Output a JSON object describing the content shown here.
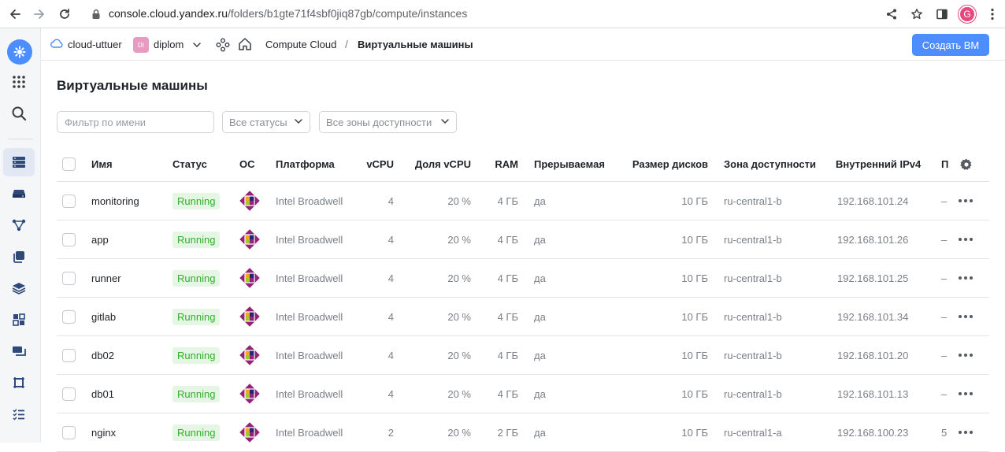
{
  "browser": {
    "url_host": "console.cloud.yandex.ru",
    "url_path": "/folders/b1gte71f4sbf0jiq87gb/compute/instances",
    "profile_initial": "G"
  },
  "header": {
    "cloud_name": "cloud-uttuer",
    "folder_badge": "DI",
    "folder_name": "diplom",
    "service": "Compute Cloud",
    "separator": "/",
    "page": "Виртуальные машины",
    "create_button": "Создать ВМ"
  },
  "page": {
    "title": "Виртуальные машины",
    "filter_placeholder": "Фильтр по имени",
    "status_select": "Все статусы",
    "zone_select": "Все зоны доступности"
  },
  "table": {
    "columns": {
      "name": "Имя",
      "status": "Статус",
      "os": "ОС",
      "platform": "Платформа",
      "vcpu": "vCPU",
      "share": "Доля vCPU",
      "ram": "RAM",
      "preemptible": "Прерываемая",
      "disk": "Размер дисков",
      "zone": "Зона доступности",
      "ipv4": "Внутренний IPv4",
      "last": "П"
    },
    "rows": [
      {
        "name": "monitoring",
        "status": "Running",
        "platform": "Intel Broadwell",
        "vcpu": "4",
        "share": "20 %",
        "ram": "4 ГБ",
        "preemptible": "да",
        "disk": "10 ГБ",
        "zone": "ru-central1-b",
        "ipv4": "192.168.101.24",
        "last": "–"
      },
      {
        "name": "app",
        "status": "Running",
        "platform": "Intel Broadwell",
        "vcpu": "4",
        "share": "20 %",
        "ram": "4 ГБ",
        "preemptible": "да",
        "disk": "10 ГБ",
        "zone": "ru-central1-b",
        "ipv4": "192.168.101.26",
        "last": "–"
      },
      {
        "name": "runner",
        "status": "Running",
        "platform": "Intel Broadwell",
        "vcpu": "4",
        "share": "20 %",
        "ram": "4 ГБ",
        "preemptible": "да",
        "disk": "10 ГБ",
        "zone": "ru-central1-b",
        "ipv4": "192.168.101.25",
        "last": "–"
      },
      {
        "name": "gitlab",
        "status": "Running",
        "platform": "Intel Broadwell",
        "vcpu": "4",
        "share": "20 %",
        "ram": "4 ГБ",
        "preemptible": "да",
        "disk": "10 ГБ",
        "zone": "ru-central1-b",
        "ipv4": "192.168.101.34",
        "last": "–"
      },
      {
        "name": "db02",
        "status": "Running",
        "platform": "Intel Broadwell",
        "vcpu": "4",
        "share": "20 %",
        "ram": "4 ГБ",
        "preemptible": "да",
        "disk": "10 ГБ",
        "zone": "ru-central1-b",
        "ipv4": "192.168.101.20",
        "last": "–"
      },
      {
        "name": "db01",
        "status": "Running",
        "platform": "Intel Broadwell",
        "vcpu": "4",
        "share": "20 %",
        "ram": "4 ГБ",
        "preemptible": "да",
        "disk": "10 ГБ",
        "zone": "ru-central1-b",
        "ipv4": "192.168.101.13",
        "last": "–"
      },
      {
        "name": "nginx",
        "status": "Running",
        "platform": "Intel Broadwell",
        "vcpu": "2",
        "share": "20 %",
        "ram": "2 ГБ",
        "preemptible": "да",
        "disk": "10 ГБ",
        "zone": "ru-central1-a",
        "ipv4": "192.168.100.23",
        "last": "5"
      }
    ]
  },
  "colors": {
    "accent": "#4c8dff",
    "running_bg": "#e6f6e4",
    "running_text": "#32ae2b"
  }
}
